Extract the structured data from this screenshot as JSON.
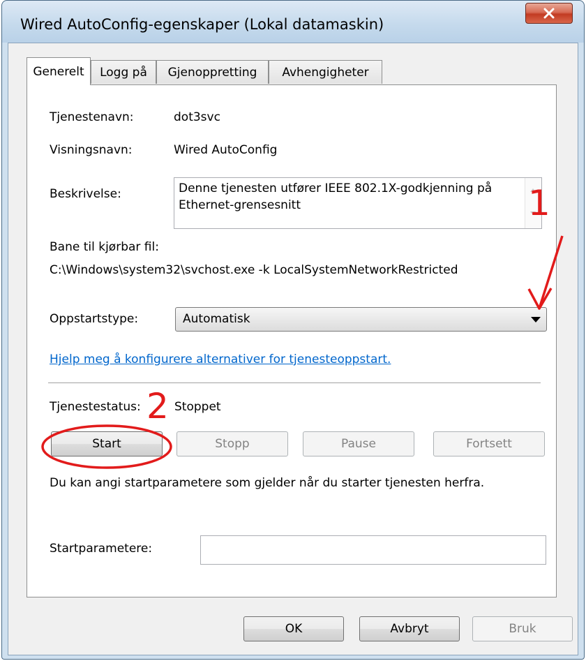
{
  "window": {
    "title": "Wired AutoConfig-egenskaper (Lokal datamaskin)"
  },
  "tabs": [
    "Generelt",
    "Logg på",
    "Gjenoppretting",
    "Avhengigheter"
  ],
  "service": {
    "name_label": "Tjenestenavn:",
    "name_value": "dot3svc",
    "display_label": "Visningsnavn:",
    "display_value": "Wired AutoConfig",
    "desc_label": "Beskrivelse:",
    "desc_value": "Denne tjenesten utfører IEEE 802.1X-godkjenning på Ethernet-grensesnitt",
    "path_label": "Bane til kjørbar fil:",
    "path_value": "C:\\Windows\\system32\\svchost.exe -k LocalSystemNetworkRestricted",
    "startup_label": "Oppstartstype:",
    "startup_value": "Automatisk",
    "help_link": "Hjelp meg å konfigurere alternativer for tjenesteoppstart.",
    "status_label": "Tjenestestatus:",
    "status_value": "Stoppet",
    "buttons": {
      "start": "Start",
      "stop": "Stopp",
      "pause": "Pause",
      "resume": "Fortsett"
    },
    "params_hint": "Du kan angi startparametere som gjelder når du starter tjenesten herfra.",
    "params_label": "Startparametere:",
    "params_value": ""
  },
  "footer": {
    "ok": "OK",
    "cancel": "Avbryt",
    "apply": "Bruk"
  },
  "annotations": {
    "marker_1": "1",
    "marker_2": "2",
    "color": "#e21b1b"
  }
}
